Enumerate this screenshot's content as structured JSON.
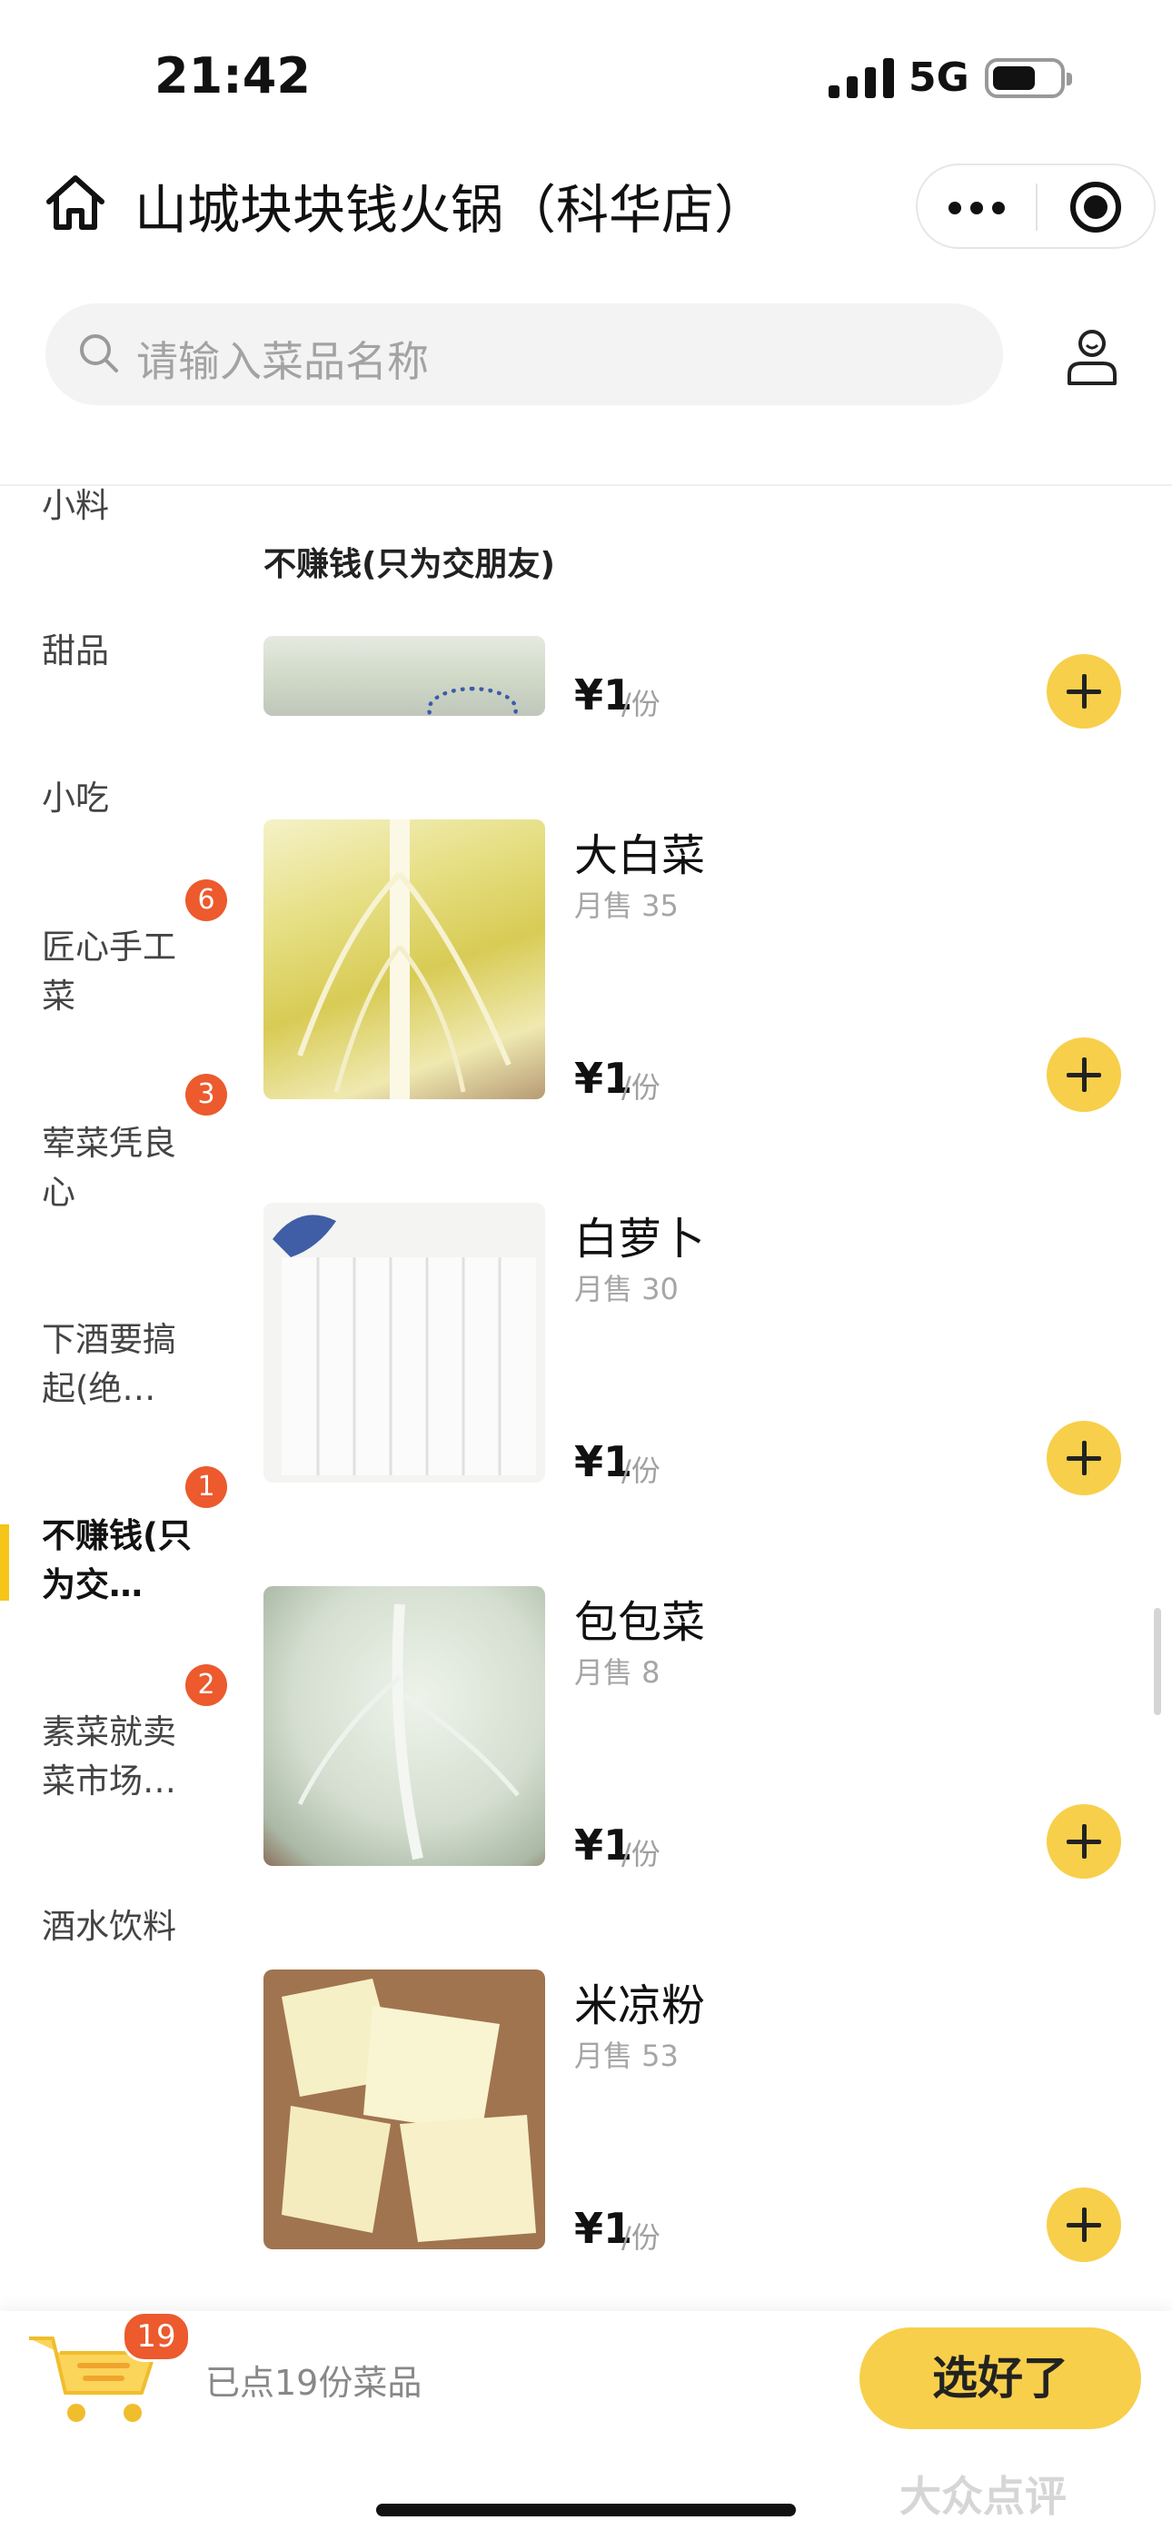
{
  "status_bar": {
    "time": "21:42",
    "network": "5G",
    "battery_level": 0.65
  },
  "header": {
    "icons": {
      "home": "home-icon",
      "more": "more-dots-icon",
      "target": "target-icon",
      "profile": "user-icon"
    },
    "store_title": "山城块块钱火锅（科华店）"
  },
  "search": {
    "placeholder": "请输入菜品名称"
  },
  "sidebar": {
    "active_color": "#f5c518",
    "badge_color": "#ec5a2d",
    "items": [
      {
        "label": "小料"
      },
      {
        "label": "甜品"
      },
      {
        "label": "小吃"
      },
      {
        "label": "匠心手工菜",
        "badge": "6"
      },
      {
        "label": "荤菜凭良心",
        "badge": "3"
      },
      {
        "label": "下酒要搞起(绝…"
      },
      {
        "label": "不赚钱(只为交…",
        "badge": "1",
        "active": true
      },
      {
        "label": "素菜就卖菜市场…",
        "badge": "2"
      },
      {
        "label": "酒水饮料"
      }
    ]
  },
  "content": {
    "category_title": "不赚钱(只为交朋友)",
    "currency": "¥",
    "unit": "/份",
    "dishes": [
      {
        "name": "",
        "sold": "",
        "price": "1"
      },
      {
        "name": "大白菜",
        "sold": "月售 35",
        "price": "1"
      },
      {
        "name": "白萝卜",
        "sold": "月售 30",
        "price": "1"
      },
      {
        "name": "包包菜",
        "sold": "月售 8",
        "price": "1"
      },
      {
        "name": "米凉粉",
        "sold": "月售 53",
        "price": "1"
      }
    ]
  },
  "cart": {
    "icon": "cart-icon",
    "count": "19",
    "summary": "已点19份菜品",
    "confirm_label": "选好了",
    "accent_color": "#f7cf4a"
  },
  "watermark": "大众点评"
}
